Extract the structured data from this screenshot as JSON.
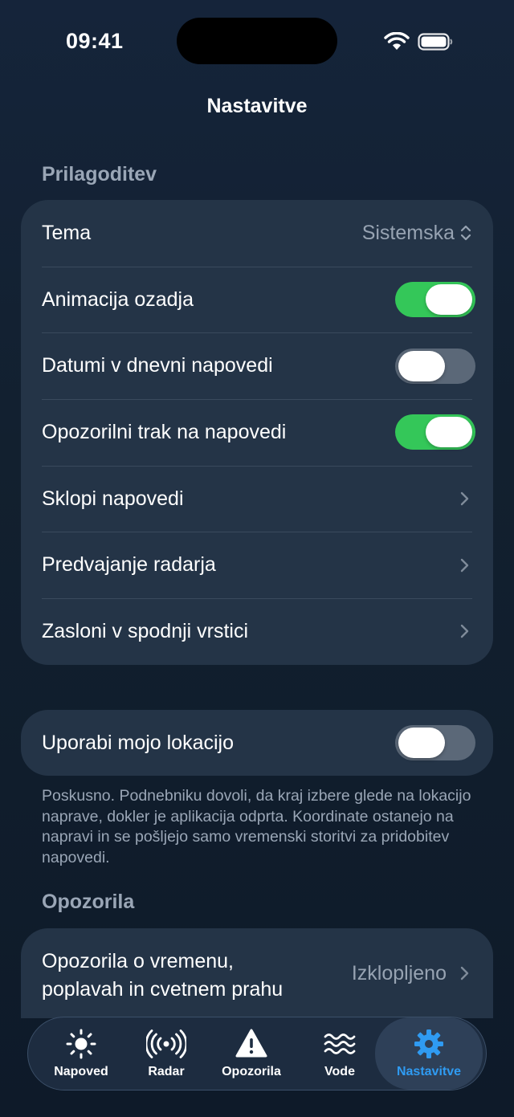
{
  "status_bar": {
    "time": "09:41"
  },
  "nav": {
    "title": "Nastavitve"
  },
  "personalization": {
    "header": "Prilagoditev",
    "theme": {
      "label": "Tema",
      "value": "Sistemska"
    },
    "toggles": [
      {
        "label": "Animacija ozadja",
        "on": true
      },
      {
        "label": "Datumi v dnevni napovedi",
        "on": false
      },
      {
        "label": "Opozorilni trak na napovedi",
        "on": true
      }
    ],
    "links": [
      {
        "label": "Sklopi napovedi"
      },
      {
        "label": "Predvajanje radarja"
      },
      {
        "label": "Zasloni v spodnji vrstici"
      }
    ]
  },
  "location": {
    "label": "Uporabi mojo lokacijo",
    "on": false,
    "footnote": "Poskusno. Podnebniku dovoli, da kraj izbere glede na lokacijo naprave, dokler je aplikacija odprta. Koordinate ostanejo na napravi in se pošljejo samo vremenski storitvi za pridobitev napovedi."
  },
  "alerts": {
    "header": "Opozorila",
    "row_label_line1": "Opozorila o vremenu,",
    "row_label_line2": "poplavah in cvetnem prahu",
    "row_value": "Izklopljeno"
  },
  "tabbar": {
    "tabs": [
      {
        "label": "Napoved",
        "icon": "sun-icon",
        "active": false
      },
      {
        "label": "Radar",
        "icon": "radar-icon",
        "active": false
      },
      {
        "label": "Opozorila",
        "icon": "warning-icon",
        "active": false
      },
      {
        "label": "Vode",
        "icon": "waves-icon",
        "active": false
      },
      {
        "label": "Nastavitve",
        "icon": "gear-icon",
        "active": true
      }
    ]
  },
  "colors": {
    "background": "#12202f",
    "card": "#243447",
    "toggle_on": "#34c759",
    "toggle_off": "#5b6878",
    "accent": "#2f9bf2",
    "secondary_text": "#9aa6b6"
  }
}
